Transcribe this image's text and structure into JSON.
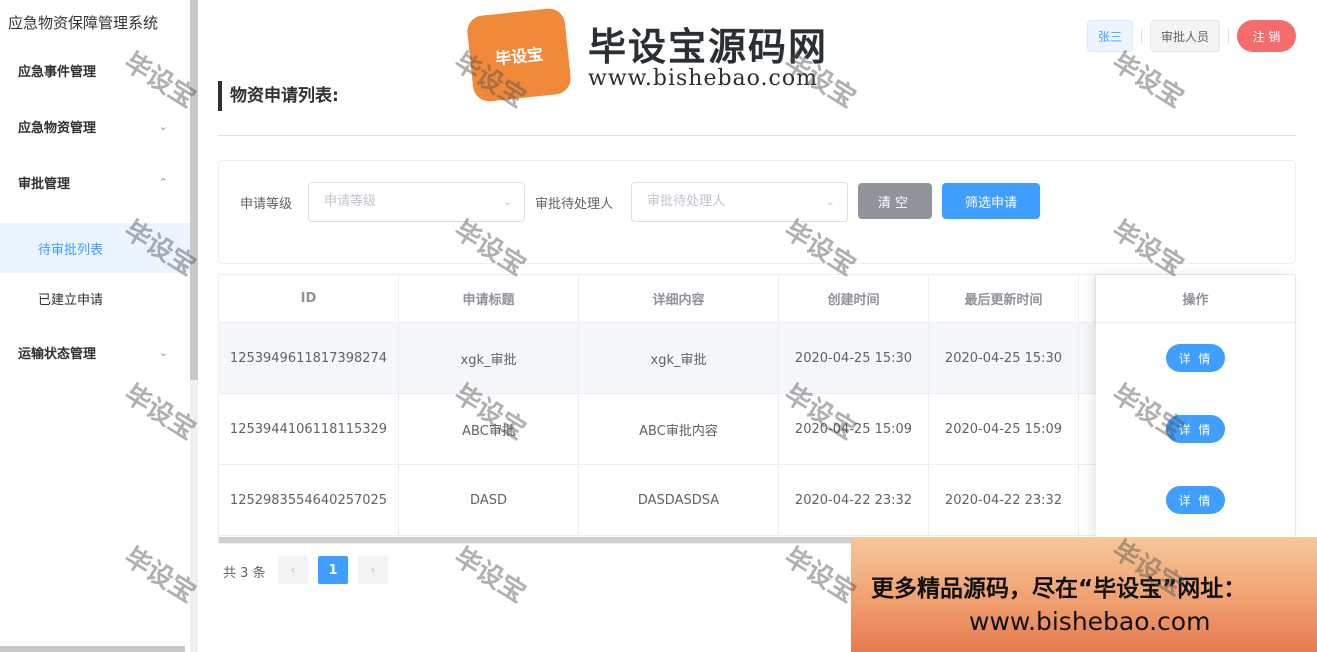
{
  "app": {
    "title": "应急物资保障管理系统"
  },
  "sidebar": {
    "items": [
      {
        "label": "应急事件管理"
      },
      {
        "label": "应急物资管理",
        "chevron": "⌄"
      },
      {
        "label": "审批管理",
        "chevron": "⌃"
      },
      {
        "label": "待审批列表",
        "active": true
      },
      {
        "label": "已建立申请"
      },
      {
        "label": "运输状态管理",
        "chevron": "⌄"
      }
    ]
  },
  "header": {
    "user": "张三",
    "role": "审批人员",
    "logout": "注 销"
  },
  "page": {
    "title": "物资申请列表:"
  },
  "filter": {
    "level_label": "申请等级",
    "level_placeholder": "申请等级",
    "handler_label": "审批待处理人",
    "handler_placeholder": "审批待处理人",
    "clear_btn": "清空",
    "filter_btn": "筛选申请"
  },
  "table": {
    "headers": [
      "ID",
      "申请标题",
      "详细内容",
      "创建时间",
      "最后更新时间",
      "操作"
    ],
    "rows": [
      {
        "id": "1253949611817398274",
        "title": "xgk_审批",
        "content": "xgk_审批",
        "created": "2020-04-25 15:30",
        "updated": "2020-04-25 15:30",
        "action": "详 情"
      },
      {
        "id": "1253944106118115329",
        "title": "ABC审批",
        "content": "ABC审批内容",
        "created": "2020-04-25 15:09",
        "updated": "2020-04-25 15:09",
        "action": "详 情"
      },
      {
        "id": "1252983554640257025",
        "title": "DASD",
        "content": "DASDASDSA",
        "created": "2020-04-22 23:32",
        "updated": "2020-04-22 23:32",
        "action": "详 情"
      }
    ]
  },
  "pagination": {
    "total": "共 3 条",
    "prev": "‹",
    "current": "1",
    "next": "›"
  },
  "watermark": {
    "brand": "毕设宝源码网",
    "url": "www.bishebao.com",
    "badge": "毕设宝",
    "stamp": "毕设宝",
    "ad_line1": "更多精品源码，尽在“毕设宝”网址：",
    "ad_line2": "www.bishebao.com"
  },
  "colors": {
    "primary": "#409eff",
    "danger": "#f56c6c",
    "info": "#909399"
  }
}
